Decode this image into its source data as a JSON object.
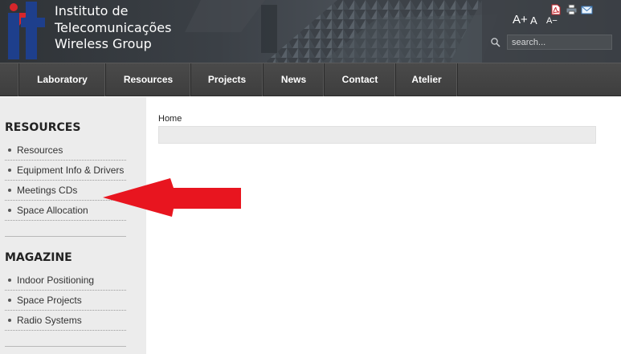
{
  "header": {
    "title_lines": [
      "Instituto de",
      "Telecomunicações",
      "Wireless Group"
    ],
    "font_controls": {
      "increase": "A+",
      "reset": "A",
      "decrease": "A−"
    },
    "search": {
      "placeholder": "search..."
    },
    "colors": {
      "logo_blue": "#1e3f8c",
      "logo_red": "#d6262b"
    }
  },
  "nav": {
    "items": [
      {
        "label": "Laboratory"
      },
      {
        "label": "Resources"
      },
      {
        "label": "Projects"
      },
      {
        "label": "News"
      },
      {
        "label": "Contact"
      },
      {
        "label": "Atelier"
      }
    ]
  },
  "sidebar": {
    "sections": [
      {
        "heading": "RESOURCES",
        "items": [
          {
            "label": "Resources"
          },
          {
            "label": "Equipment Info & Drivers"
          },
          {
            "label": "Meetings CDs"
          },
          {
            "label": "Space Allocation"
          }
        ]
      },
      {
        "heading": "MAGAZINE",
        "items": [
          {
            "label": "Indoor Positioning"
          },
          {
            "label": "Space Projects"
          },
          {
            "label": "Radio Systems"
          }
        ]
      }
    ]
  },
  "main": {
    "breadcrumb": "Home",
    "tools": [
      {
        "icon": "pdf-icon"
      },
      {
        "icon": "print-icon"
      },
      {
        "icon": "email-icon"
      }
    ]
  },
  "annotation": {
    "color": "#e8151f",
    "points_to": "Meetings CDs"
  }
}
